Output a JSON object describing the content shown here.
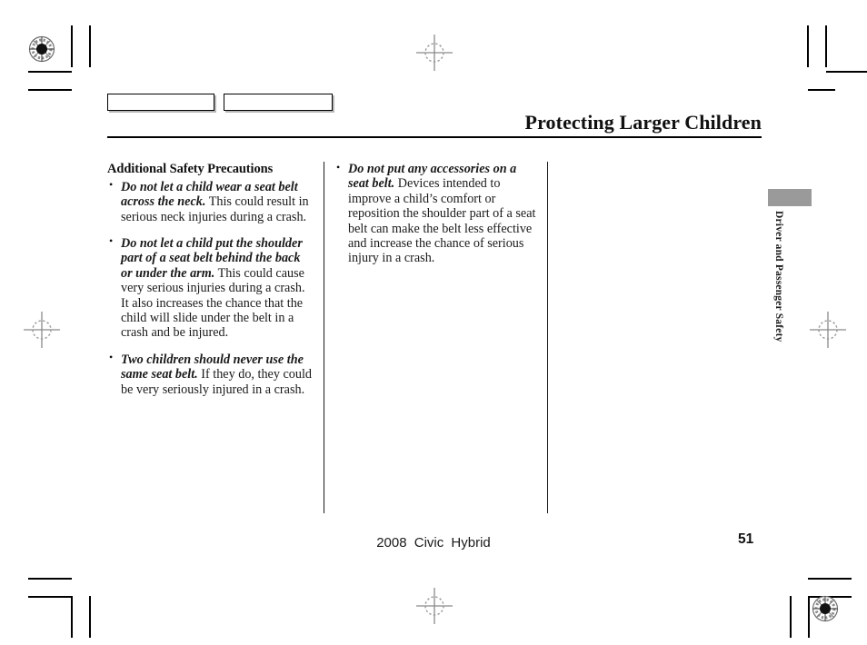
{
  "document": {
    "title": "Protecting Larger Children",
    "footer": "2008  Civic  Hybrid",
    "page_number": "51",
    "side_tab_label": "Driver and Passenger Safety"
  },
  "left_column": {
    "heading": "Additional Safety Precautions",
    "bullets": [
      {
        "lead": "Do not let a child wear a seat belt across the neck.",
        "body": " This could result in serious neck injuries during a crash."
      },
      {
        "lead": "Do not let a child put the shoulder part of a seat belt behind the back or under the arm.",
        "body": " This could cause very serious injuries during a crash. It also increases the chance that the child will slide under the belt in a crash and be injured."
      },
      {
        "lead": "Two children should never use the same seat belt.",
        "body": " If they do, they could be very seriously injured in a crash."
      }
    ]
  },
  "right_column": {
    "bullets": [
      {
        "lead": "Do not put any accessories on a seat belt.",
        "body": " Devices intended to improve a child’s comfort or reposition the shoulder part of a seat belt can make the belt less effective and increase the chance of serious injury in a crash."
      }
    ]
  },
  "print_marks": {
    "color_bar_count": 2,
    "registration_target_color": "#2b2b2b",
    "crosshair_color": "#8a8a8a",
    "crop_mark_color": "#000000",
    "tab_swatch_color": "#9a9a9a"
  }
}
